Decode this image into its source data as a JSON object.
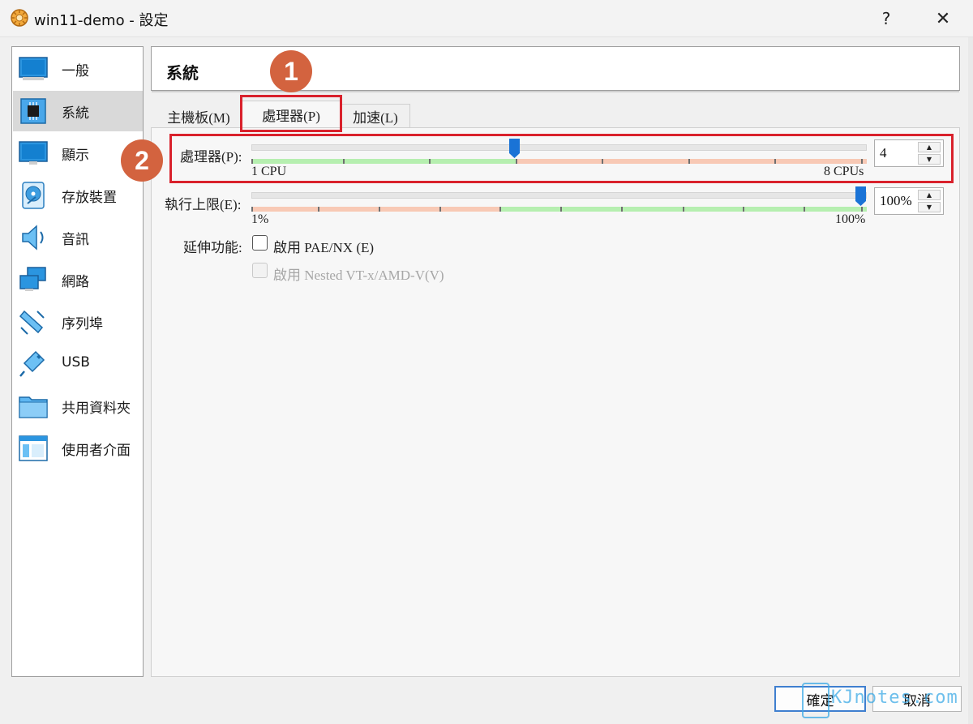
{
  "window": {
    "title": "win11-demo - 設定",
    "help_label": "?",
    "close_label": "✕"
  },
  "sidebar": {
    "items": [
      {
        "label": "一般",
        "icon": "monitor-icon"
      },
      {
        "label": "系統",
        "icon": "chip-icon",
        "active": true
      },
      {
        "label": "顯示",
        "icon": "display-icon"
      },
      {
        "label": "存放裝置",
        "icon": "disk-icon"
      },
      {
        "label": "音訊",
        "icon": "speaker-icon"
      },
      {
        "label": "網路",
        "icon": "network-icon"
      },
      {
        "label": "序列埠",
        "icon": "serial-icon"
      },
      {
        "label": "USB",
        "icon": "usb-icon"
      },
      {
        "label": "共用資料夾",
        "icon": "folder-icon"
      },
      {
        "label": "使用者介面",
        "icon": "window-icon"
      }
    ]
  },
  "header": {
    "title": "系統"
  },
  "annotations": {
    "badge_1": "1",
    "badge_2": "2"
  },
  "tabs": [
    {
      "label": "主機板(M)"
    },
    {
      "label": "處理器(P)",
      "active": true
    },
    {
      "label": "加速(L)"
    }
  ],
  "processor": {
    "cpu_label": "處理器(P):",
    "cpu_min_label": "1 CPU",
    "cpu_max_label": "8 CPUs",
    "cpu_value": "4",
    "cap_label": "執行上限(E):",
    "cap_min_label": "1%",
    "cap_max_label": "100%",
    "cap_value": "100%",
    "ext_label": "延伸功能:",
    "pae_label": "啟用 PAE/NX (E)",
    "nested_label": "啟用 Nested VT-x/AMD-V(V)"
  },
  "buttons": {
    "ok": "確定",
    "cancel": "取消"
  },
  "watermark": {
    "text": "KJnotes.com"
  },
  "colors": {
    "annotation_badge": "#d3633f",
    "highlight_box": "#d9212c",
    "slider_handle": "#1a73d6",
    "scale_green": "#b6efb0",
    "scale_salmon": "#f8c9b5"
  }
}
